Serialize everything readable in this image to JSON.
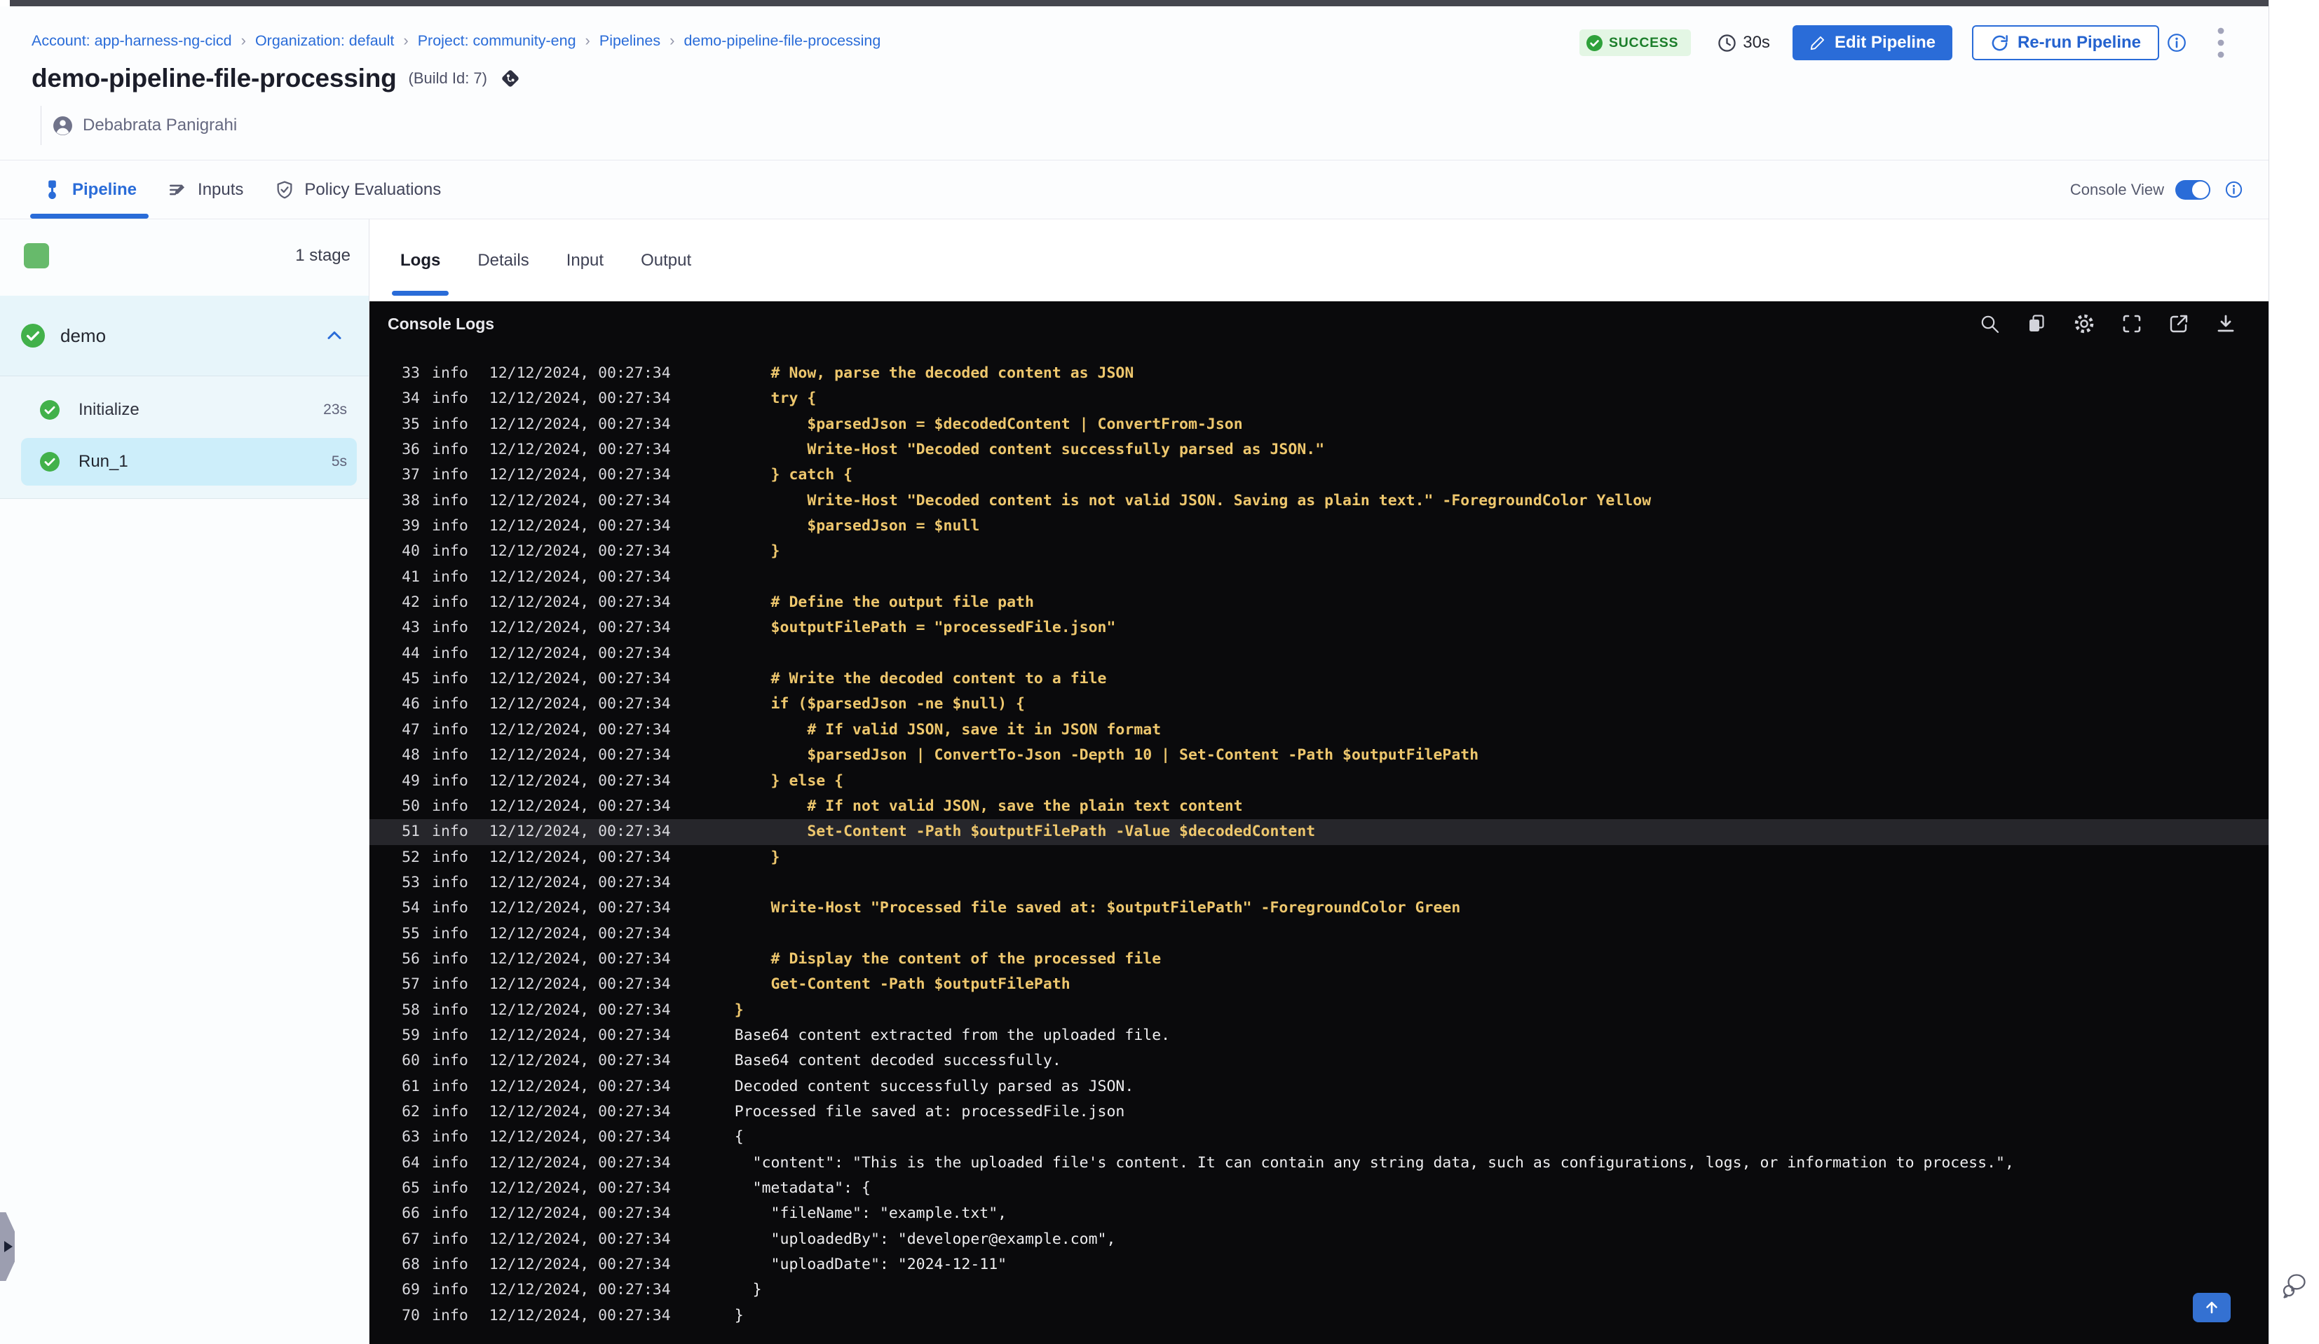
{
  "breadcrumb": {
    "separator": "›",
    "items": [
      "Account: app-harness-ng-cicd",
      "Organization: default",
      "Project: community-eng",
      "Pipelines",
      "demo-pipeline-file-processing"
    ]
  },
  "header": {
    "title": "demo-pipeline-file-processing",
    "build_id_label": "(Build Id: 7)",
    "author": "Debabrata Panigrahi"
  },
  "status": {
    "label": "SUCCESS",
    "duration": "30s"
  },
  "toolbar": {
    "edit_label": "Edit Pipeline",
    "rerun_label": "Re-run Pipeline"
  },
  "main_tabs": [
    {
      "id": "pipeline",
      "label": "Pipeline",
      "icon": "pipeline-icon",
      "active": true
    },
    {
      "id": "inputs",
      "label": "Inputs",
      "icon": "inputs-icon",
      "active": false
    },
    {
      "id": "policy-evaluations",
      "label": "Policy Evaluations",
      "icon": "shield-check-icon",
      "active": false
    }
  ],
  "console_view": {
    "label": "Console View",
    "enabled": true
  },
  "stage_panel": {
    "summary": "1 stage",
    "group": {
      "name": "demo",
      "status": "success",
      "expanded": true
    },
    "steps": [
      {
        "label": "Initialize",
        "duration": "23s",
        "status": "success",
        "selected": false
      },
      {
        "label": "Run_1",
        "duration": "5s",
        "status": "success",
        "selected": true
      }
    ]
  },
  "log_tabs": [
    {
      "label": "Logs",
      "active": true
    },
    {
      "label": "Details",
      "active": false
    },
    {
      "label": "Input",
      "active": false
    },
    {
      "label": "Output",
      "active": false
    }
  ],
  "console": {
    "title": "Console Logs",
    "toolbar_icons": [
      "search",
      "copy",
      "settings",
      "fullscreen",
      "open-in-new",
      "download"
    ],
    "level": "info",
    "time": "12/12/2024, 00:27:34",
    "logs": [
      {
        "n": 33,
        "text": "    # Now, parse the decoded content as JSON",
        "color": "yellow"
      },
      {
        "n": 34,
        "text": "    try {",
        "color": "yellow"
      },
      {
        "n": 35,
        "text": "        $parsedJson = $decodedContent | ConvertFrom-Json",
        "color": "yellow"
      },
      {
        "n": 36,
        "text": "        Write-Host \"Decoded content successfully parsed as JSON.\"",
        "color": "yellow"
      },
      {
        "n": 37,
        "text": "    } catch {",
        "color": "yellow"
      },
      {
        "n": 38,
        "text": "        Write-Host \"Decoded content is not valid JSON. Saving as plain text.\" -ForegroundColor Yellow",
        "color": "yellow"
      },
      {
        "n": 39,
        "text": "        $parsedJson = $null",
        "color": "yellow"
      },
      {
        "n": 40,
        "text": "    }",
        "color": "yellow"
      },
      {
        "n": 41,
        "text": "",
        "color": "yellow"
      },
      {
        "n": 42,
        "text": "    # Define the output file path",
        "color": "yellow"
      },
      {
        "n": 43,
        "text": "    $outputFilePath = \"processedFile.json\"",
        "color": "yellow"
      },
      {
        "n": 44,
        "text": "",
        "color": "yellow"
      },
      {
        "n": 45,
        "text": "    # Write the decoded content to a file",
        "color": "yellow"
      },
      {
        "n": 46,
        "text": "    if ($parsedJson -ne $null) {",
        "color": "yellow"
      },
      {
        "n": 47,
        "text": "        # If valid JSON, save it in JSON format",
        "color": "yellow"
      },
      {
        "n": 48,
        "text": "        $parsedJson | ConvertTo-Json -Depth 10 | Set-Content -Path $outputFilePath",
        "color": "yellow"
      },
      {
        "n": 49,
        "text": "    } else {",
        "color": "yellow"
      },
      {
        "n": 50,
        "text": "        # If not valid JSON, save the plain text content",
        "color": "yellow"
      },
      {
        "n": 51,
        "text": "        Set-Content -Path $outputFilePath -Value $decodedContent",
        "color": "yellow",
        "highlight": true
      },
      {
        "n": 52,
        "text": "    }",
        "color": "yellow"
      },
      {
        "n": 53,
        "text": "",
        "color": "yellow"
      },
      {
        "n": 54,
        "text": "    Write-Host \"Processed file saved at: $outputFilePath\" -ForegroundColor Green",
        "color": "yellow"
      },
      {
        "n": 55,
        "text": "",
        "color": "yellow"
      },
      {
        "n": 56,
        "text": "    # Display the content of the processed file",
        "color": "yellow"
      },
      {
        "n": 57,
        "text": "    Get-Content -Path $outputFilePath",
        "color": "yellow"
      },
      {
        "n": 58,
        "text": "}",
        "color": "yellow"
      },
      {
        "n": 59,
        "text": "Base64 content extracted from the uploaded file.",
        "color": "white"
      },
      {
        "n": 60,
        "text": "Base64 content decoded successfully.",
        "color": "white"
      },
      {
        "n": 61,
        "text": "Decoded content successfully parsed as JSON.",
        "color": "white"
      },
      {
        "n": 62,
        "text": "Processed file saved at: processedFile.json",
        "color": "white"
      },
      {
        "n": 63,
        "text": "{",
        "color": "white"
      },
      {
        "n": 64,
        "text": "  \"content\": \"This is the uploaded file's content. It can contain any string data, such as configurations, logs, or information to process.\",",
        "color": "white"
      },
      {
        "n": 65,
        "text": "  \"metadata\": {",
        "color": "white"
      },
      {
        "n": 66,
        "text": "    \"fileName\": \"example.txt\",",
        "color": "white"
      },
      {
        "n": 67,
        "text": "    \"uploadedBy\": \"developer@example.com\",",
        "color": "white"
      },
      {
        "n": 68,
        "text": "    \"uploadDate\": \"2024-12-11\"",
        "color": "white"
      },
      {
        "n": 69,
        "text": "  }",
        "color": "white"
      },
      {
        "n": 70,
        "text": "}",
        "color": "white"
      }
    ]
  },
  "colors": {
    "accent": "#2a6cd8",
    "success_green": "#42b14a",
    "stage_square_green": "#67ba6b",
    "badge_bg": "#e3f6e4",
    "badge_text": "#1c7e2b",
    "console_bg": "#0a0a0c",
    "log_yellow": "#eec76d",
    "log_white": "#ededef",
    "log_meta": "#d8d8dd",
    "row_highlight_bg": "#26262b",
    "selected_step_bg": "#cdeefa",
    "group_header_bg": "#e7f5fa",
    "steps_block_bg": "#edf7fb"
  }
}
